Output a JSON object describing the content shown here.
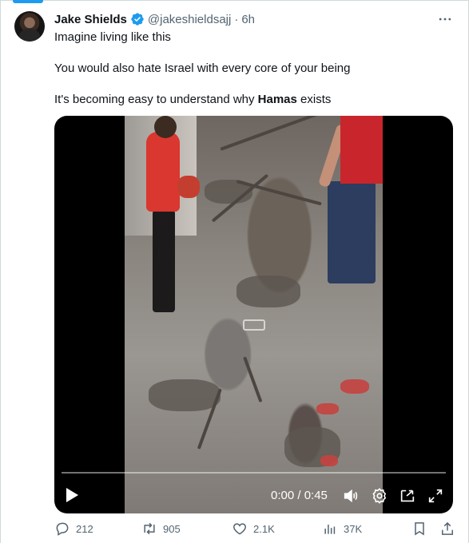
{
  "tweet": {
    "author": {
      "display_name": "Jake Shields",
      "handle": "@jakeshieldsajj",
      "separator": "·",
      "time": "6h",
      "verified": true
    },
    "text_lines": [
      "Imagine living like this",
      "You would also hate Israel with every core of your being",
      "It's becoming easy to understand why "
    ],
    "text_bold": "Hamas",
    "text_tail": " exists"
  },
  "video": {
    "time_display": "0:00 / 0:45",
    "progress": 0
  },
  "actions": {
    "replies": "212",
    "retweets": "905",
    "likes": "2.1K",
    "views": "37K"
  },
  "colors": {
    "accent": "#1d9bf0",
    "secondary_text": "#536471",
    "primary_text": "#0f1419"
  }
}
